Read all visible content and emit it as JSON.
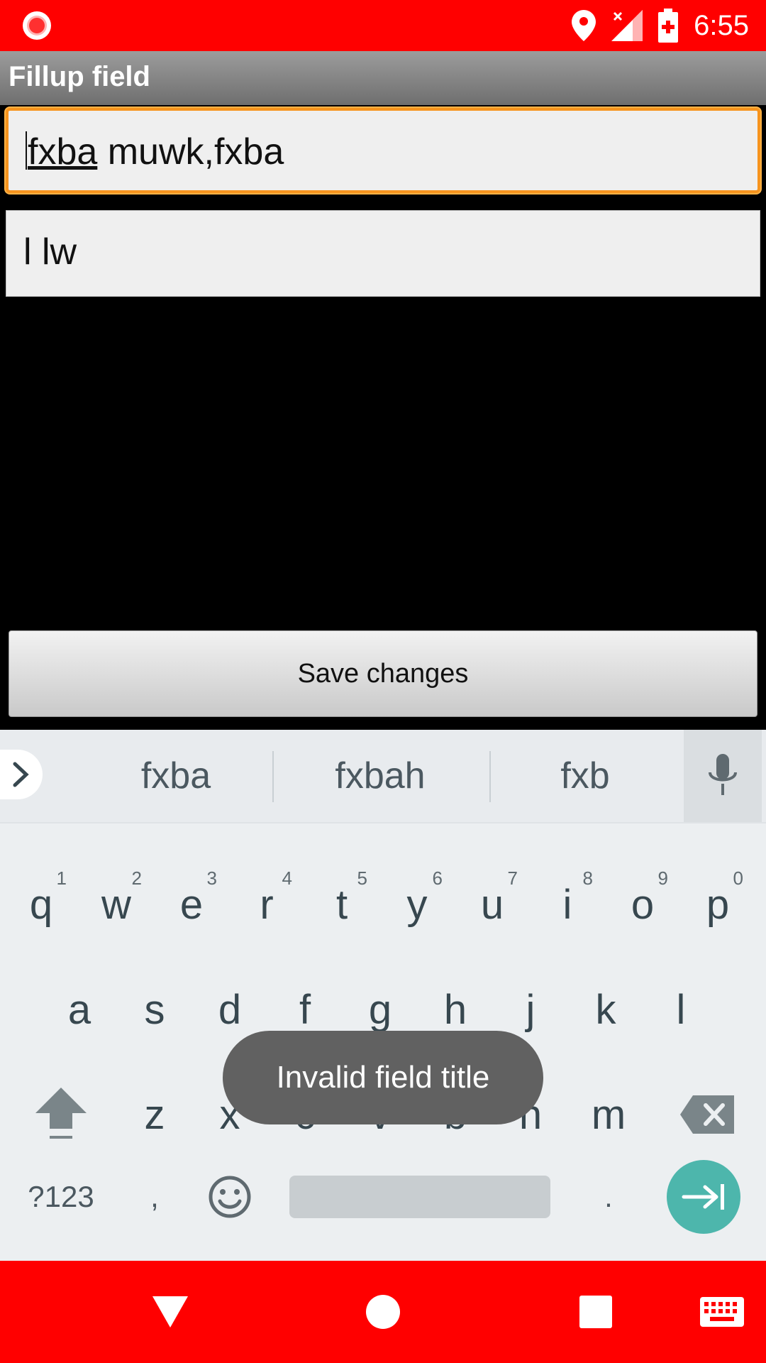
{
  "status_bar": {
    "time": "6:55"
  },
  "title_bar": {
    "title": "Fillup field"
  },
  "fields": {
    "field1": {
      "value_underlined": "fxba",
      "value_rest": " muwk,fxba"
    },
    "field2": {
      "value": "l lw"
    }
  },
  "save_button": {
    "label": "Save changes"
  },
  "keyboard": {
    "suggestions": [
      "fxba",
      "fxbah",
      "fxb"
    ],
    "row1": [
      {
        "k": "q",
        "h": "1"
      },
      {
        "k": "w",
        "h": "2"
      },
      {
        "k": "e",
        "h": "3"
      },
      {
        "k": "r",
        "h": "4"
      },
      {
        "k": "t",
        "h": "5"
      },
      {
        "k": "y",
        "h": "6"
      },
      {
        "k": "u",
        "h": "7"
      },
      {
        "k": "i",
        "h": "8"
      },
      {
        "k": "o",
        "h": "9"
      },
      {
        "k": "p",
        "h": "0"
      }
    ],
    "row2": [
      "a",
      "s",
      "d",
      "f",
      "g",
      "h",
      "j",
      "k",
      "l"
    ],
    "row3": [
      "z",
      "x",
      "c",
      "v",
      "b",
      "n",
      "m"
    ],
    "symbols_label": "?123",
    "comma_label": ",",
    "period_label": "."
  },
  "toast": {
    "message": "Invalid field title"
  },
  "colors": {
    "status_bar": "#ff0000",
    "field_focus": "#f7941e",
    "enter_key": "#4db6ac",
    "toast_bg": "#616161"
  },
  "icons": [
    "record-icon",
    "location-icon",
    "signal-icon",
    "battery-icon",
    "chevron-right-icon",
    "mic-icon",
    "shift-icon",
    "backspace-icon",
    "emoji-icon",
    "enter-arrow-icon",
    "back-icon",
    "home-icon",
    "recents-icon",
    "keyboard-icon"
  ]
}
